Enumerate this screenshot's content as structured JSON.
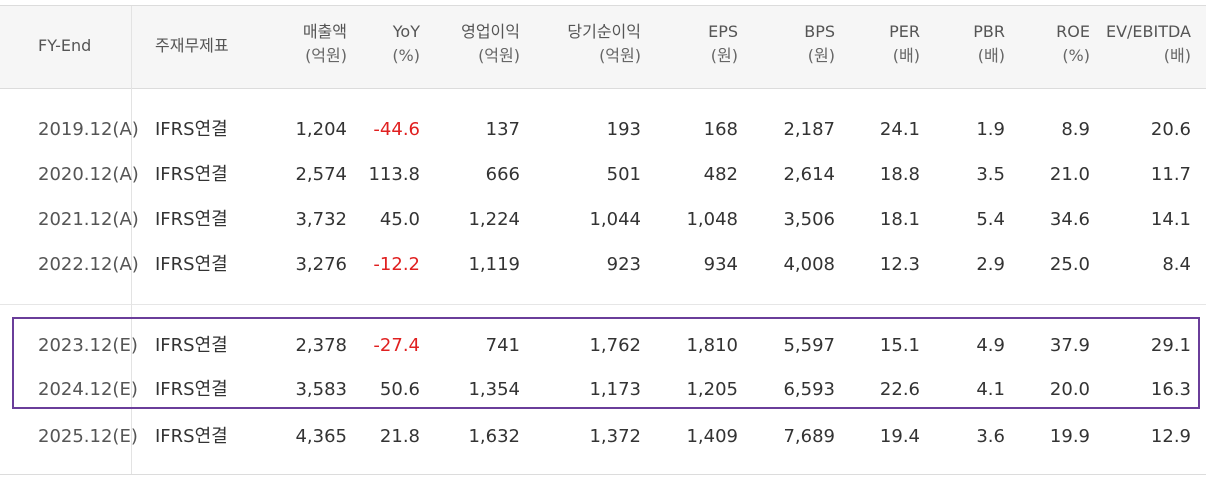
{
  "columns": [
    {
      "key": "fy",
      "label": "FY-End",
      "sub": ""
    },
    {
      "key": "basis",
      "label": "주재무제표",
      "sub": ""
    },
    {
      "key": "revenue",
      "label": "매출액",
      "sub": "(억원)"
    },
    {
      "key": "yoy",
      "label": "YoY",
      "sub": "(%)"
    },
    {
      "key": "op",
      "label": "영업이익",
      "sub": "(억원)"
    },
    {
      "key": "net",
      "label": "당기순이익",
      "sub": "(억원)"
    },
    {
      "key": "eps",
      "label": "EPS",
      "sub": "(원)"
    },
    {
      "key": "bps",
      "label": "BPS",
      "sub": "(원)"
    },
    {
      "key": "per",
      "label": "PER",
      "sub": "(배)"
    },
    {
      "key": "pbr",
      "label": "PBR",
      "sub": "(배)"
    },
    {
      "key": "roe",
      "label": "ROE",
      "sub": "(%)"
    },
    {
      "key": "ev",
      "label": "EV/EBITDA",
      "sub": "(배)"
    }
  ],
  "rows": [
    {
      "fy": "2019.12(A)",
      "basis": "IFRS연결",
      "revenue": "1,204",
      "yoy": "-44.6",
      "op": "137",
      "net": "193",
      "eps": "168",
      "bps": "2,187",
      "per": "24.1",
      "pbr": "1.9",
      "roe": "8.9",
      "ev": "20.6"
    },
    {
      "fy": "2020.12(A)",
      "basis": "IFRS연결",
      "revenue": "2,574",
      "yoy": "113.8",
      "op": "666",
      "net": "501",
      "eps": "482",
      "bps": "2,614",
      "per": "18.8",
      "pbr": "3.5",
      "roe": "21.0",
      "ev": "11.7"
    },
    {
      "fy": "2021.12(A)",
      "basis": "IFRS연결",
      "revenue": "3,732",
      "yoy": "45.0",
      "op": "1,224",
      "net": "1,044",
      "eps": "1,048",
      "bps": "3,506",
      "per": "18.1",
      "pbr": "5.4",
      "roe": "34.6",
      "ev": "14.1"
    },
    {
      "fy": "2022.12(A)",
      "basis": "IFRS연결",
      "revenue": "3,276",
      "yoy": "-12.2",
      "op": "1,119",
      "net": "923",
      "eps": "934",
      "bps": "4,008",
      "per": "12.3",
      "pbr": "2.9",
      "roe": "25.0",
      "ev": "8.4"
    },
    {
      "fy": "2023.12(E)",
      "basis": "IFRS연결",
      "revenue": "2,378",
      "yoy": "-27.4",
      "op": "741",
      "net": "1,762",
      "eps": "1,810",
      "bps": "5,597",
      "per": "15.1",
      "pbr": "4.9",
      "roe": "37.9",
      "ev": "29.1"
    },
    {
      "fy": "2024.12(E)",
      "basis": "IFRS연결",
      "revenue": "3,583",
      "yoy": "50.6",
      "op": "1,354",
      "net": "1,173",
      "eps": "1,205",
      "bps": "6,593",
      "per": "22.6",
      "pbr": "4.1",
      "roe": "20.0",
      "ev": "16.3"
    },
    {
      "fy": "2025.12(E)",
      "basis": "IFRS연결",
      "revenue": "4,365",
      "yoy": "21.8",
      "op": "1,632",
      "net": "1,372",
      "eps": "1,409",
      "bps": "7,689",
      "per": "19.4",
      "pbr": "3.6",
      "roe": "19.9",
      "ev": "12.9"
    }
  ],
  "colors": {
    "negative": "#e02020",
    "highlight_border": "#6a3d9a"
  }
}
